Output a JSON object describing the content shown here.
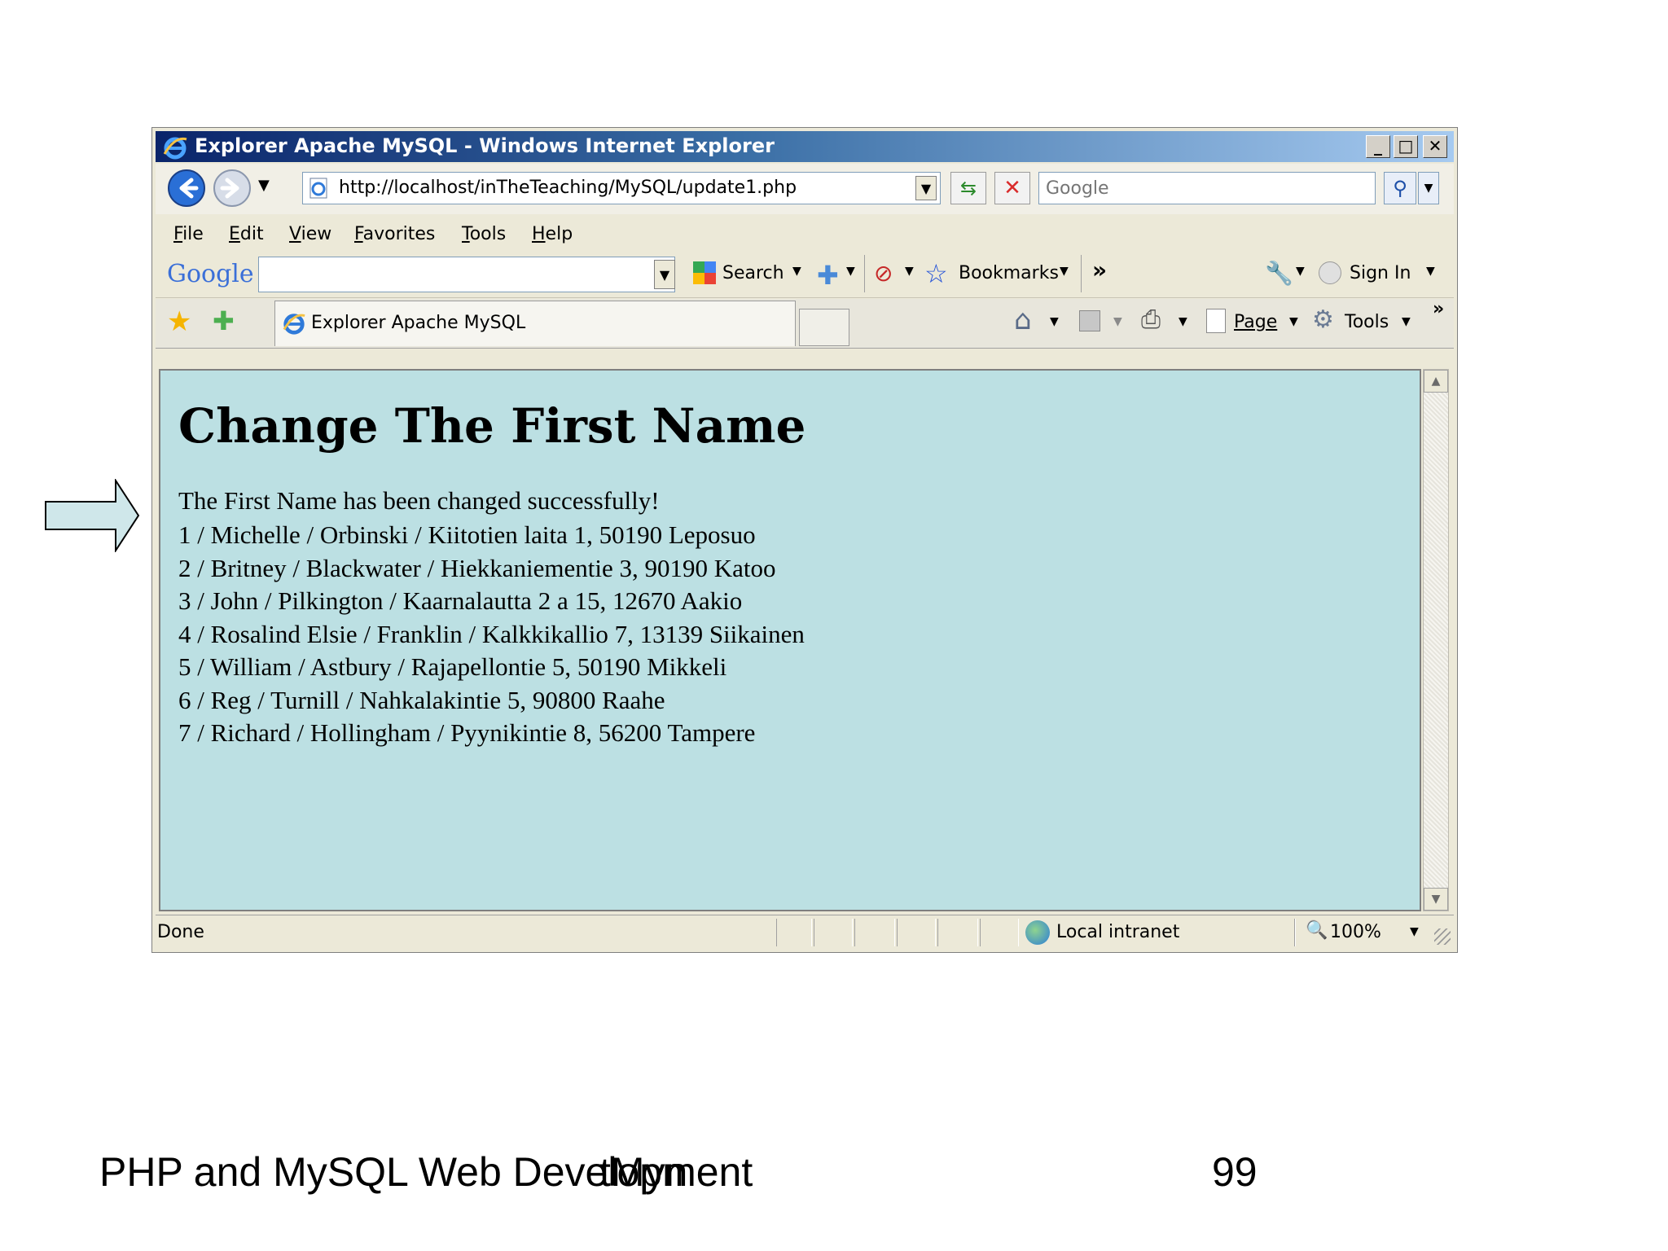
{
  "window": {
    "title": "Explorer Apache MySQL - Windows Internet Explorer",
    "minimize": "_",
    "maximize": "□",
    "close": "✕"
  },
  "nav": {
    "address": "http://localhost/inTheTeaching/MySQL/update1.php",
    "search_placeholder": "Google"
  },
  "menu": [
    "File",
    "Edit",
    "View",
    "Favorites",
    "Tools",
    "Help"
  ],
  "google_toolbar": {
    "logo": "Google",
    "search_label": "Search",
    "bookmarks_label": "Bookmarks",
    "more_label": "»",
    "signin_label": "Sign In"
  },
  "tabs": {
    "active_tab_label": "Explorer Apache MySQL",
    "page_label": "Page",
    "tools_label": "Tools",
    "more_label": "»"
  },
  "page": {
    "heading": "Change The First Name",
    "message": "The First Name has been changed successfully!",
    "records": [
      "1 / Michelle / Orbinski / Kiitotien laita 1, 50190 Leposuo",
      "2 / Britney / Blackwater / Hiekkaniementie 3, 90190 Katoo",
      "3 / John / Pilkington / Kaarnalautta 2 a 15, 12670 Aakio",
      "4 / Rosalind Elsie / Franklin / Kalkkikallio 7, 13139 Siikainen",
      "5 / William / Astbury / Rajapellontie 5, 50190 Mikkeli",
      "6 / Reg / Turnill / Nahkalakintie 5, 90800 Raahe",
      "7 / Richard / Hollingham / Pyynikintie 8, 56200 Tampere"
    ]
  },
  "status": {
    "text": "Done",
    "zone": "Local intranet",
    "zoom": "100%"
  },
  "slide": {
    "footer_title": "PHP and MySQL Web Development",
    "footer_overlay": "tMyn",
    "page_number": "99"
  },
  "colors": {
    "content_bg": "#bce0e3",
    "arrow_fill": "#cfe7ea",
    "title_bar_start": "#0a246a",
    "title_bar_end": "#a6caf0"
  }
}
